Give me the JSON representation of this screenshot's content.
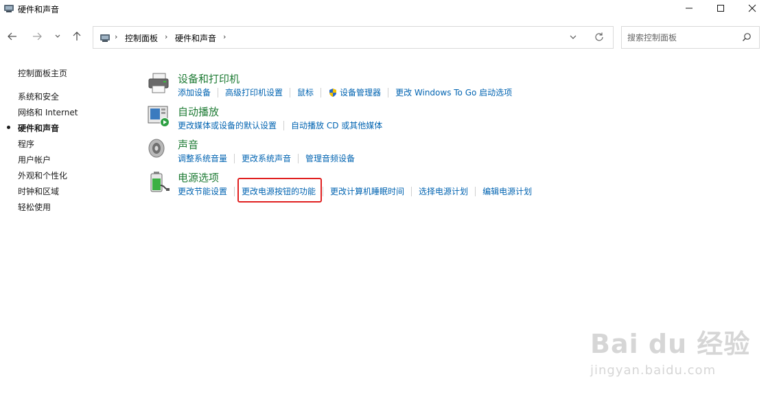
{
  "window": {
    "title": "硬件和声音",
    "controls": [
      "minimize-icon",
      "maximize-icon",
      "close-icon"
    ]
  },
  "nav": {
    "back_icon": "arrow-left-icon",
    "forward_icon": "arrow-right-icon",
    "recent_icon": "chevron-down-icon",
    "up_icon": "arrow-up-icon"
  },
  "address": {
    "breadcrumbs": [
      "控制面板",
      "硬件和声音"
    ],
    "separator": "›"
  },
  "search": {
    "placeholder": "搜索控制面板"
  },
  "sidebar": {
    "items": [
      {
        "label": "控制面板主页",
        "active": false
      },
      {
        "label": "系统和安全",
        "active": false
      },
      {
        "label": "网络和 Internet",
        "active": false
      },
      {
        "label": "硬件和声音",
        "active": true
      },
      {
        "label": "程序",
        "active": false
      },
      {
        "label": "用户帐户",
        "active": false
      },
      {
        "label": "外观和个性化",
        "active": false
      },
      {
        "label": "时钟和区域",
        "active": false
      },
      {
        "label": "轻松使用",
        "active": false
      }
    ]
  },
  "categories": [
    {
      "title": "设备和打印机",
      "icon": "printer-icon",
      "links": [
        "添加设备",
        "高级打印机设置",
        "鼠标",
        "设备管理器",
        "更改 Windows To Go 启动选项"
      ]
    },
    {
      "title": "自动播放",
      "icon": "autoplay-icon",
      "links": [
        "更改媒体或设备的默认设置",
        "自动播放 CD 或其他媒体"
      ]
    },
    {
      "title": "声音",
      "icon": "speaker-icon",
      "links": [
        "调整系统音量",
        "更改系统声音",
        "管理音频设备"
      ]
    },
    {
      "title": "电源选项",
      "icon": "battery-icon",
      "links": [
        "更改节能设置",
        "更改电源按钮的功能",
        "更改计算机睡眠时间",
        "选择电源计划",
        "编辑电源计划"
      ]
    }
  ],
  "colors": {
    "category_title": "#1e7b34",
    "link": "#0063b1",
    "highlight_box": "#e02020"
  },
  "watermark": {
    "brand": "Bai du 经验",
    "url": "jingyan.baidu.com"
  }
}
